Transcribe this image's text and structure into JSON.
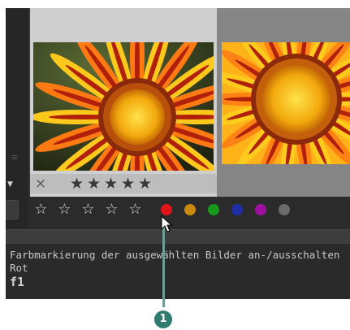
{
  "thumbnail": {
    "reject_symbol": "×",
    "stars": [
      "★",
      "★",
      "★",
      "★",
      "★"
    ]
  },
  "toolbar": {
    "star_symbol": "☆",
    "color_labels": [
      {
        "name": "red",
        "color": "#e0141a"
      },
      {
        "name": "yellow",
        "color": "#c88a0c"
      },
      {
        "name": "green",
        "color": "#159a1d"
      },
      {
        "name": "blue",
        "color": "#1d2ea6"
      },
      {
        "name": "purple",
        "color": "#9e0f9e"
      },
      {
        "name": "gray",
        "color": "#6b6b6b"
      }
    ]
  },
  "tooltip": {
    "description": "Farbmarkierung der ausgewählten Bilder an-/ausschalten",
    "name": "Rot",
    "shortcut": "f1"
  },
  "callout": {
    "number": "1"
  }
}
